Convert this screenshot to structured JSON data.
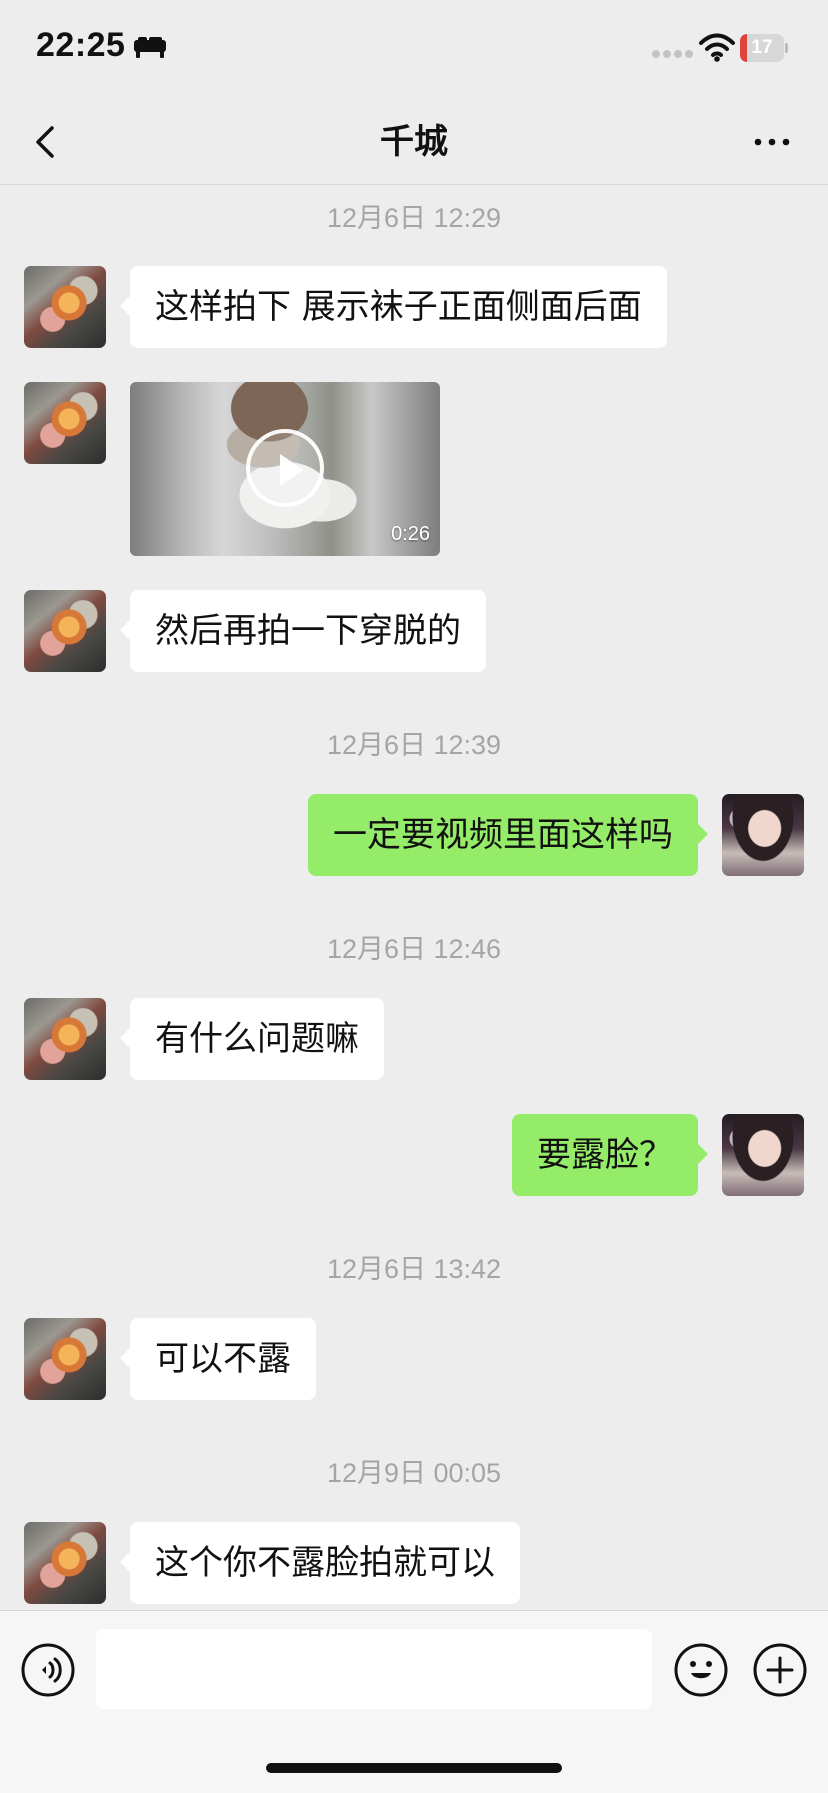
{
  "status_bar": {
    "time": "22:25",
    "battery": "17",
    "battery_level_percent": 17,
    "icons": [
      "bed-icon",
      "signal-icon",
      "wifi-icon",
      "battery-icon"
    ]
  },
  "nav": {
    "title": "千城",
    "back_icon": "chevron-left-icon",
    "more_icon": "more-icon"
  },
  "messages": [
    {
      "type": "timestamp",
      "text": "12月6日 12:29"
    },
    {
      "type": "text",
      "side": "left",
      "text": "这样拍下 展示袜子正面侧面后面"
    },
    {
      "type": "video",
      "side": "left",
      "duration": "0:26",
      "icon": "play-icon"
    },
    {
      "type": "text",
      "side": "left",
      "text": "然后再拍一下穿脱的"
    },
    {
      "type": "timestamp",
      "text": "12月6日 12:39"
    },
    {
      "type": "text",
      "side": "right",
      "text": "一定要视频里面这样吗"
    },
    {
      "type": "timestamp",
      "text": "12月6日 12:46"
    },
    {
      "type": "text",
      "side": "left",
      "text": "有什么问题嘛"
    },
    {
      "type": "text",
      "side": "right",
      "text": "要露脸？"
    },
    {
      "type": "timestamp",
      "text": "12月6日 13:42"
    },
    {
      "type": "text",
      "side": "left",
      "text": "可以不露"
    },
    {
      "type": "timestamp",
      "text": "12月9日 00:05"
    },
    {
      "type": "text",
      "side": "left",
      "text": "这个你不露脸拍就可以"
    }
  ],
  "input_bar": {
    "voice_icon": "voice-icon",
    "text_value": "",
    "emoji_icon": "emoji-icon",
    "plus_icon": "plus-icon"
  },
  "colors": {
    "background": "#ededed",
    "incoming_bubble": "#ffffff",
    "outgoing_bubble": "#95ec69",
    "timestamp": "#a5a5a5",
    "battery_fill": "#e0443c"
  }
}
